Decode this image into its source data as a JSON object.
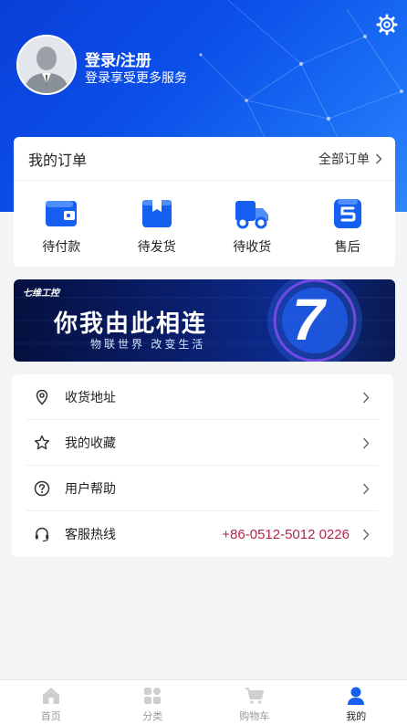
{
  "profile": {
    "login_title": "登录/注册",
    "login_subtitle": "登录享受更多服务",
    "avatar_icon": "avatar-placeholder-icon",
    "settings_icon": "gear-icon"
  },
  "orders": {
    "title": "我的订单",
    "all_label": "全部订单",
    "items": [
      {
        "label": "待付款",
        "icon": "wallet-icon"
      },
      {
        "label": "待发货",
        "icon": "package-icon"
      },
      {
        "label": "待收货",
        "icon": "truck-icon"
      },
      {
        "label": "售后",
        "icon": "after-sale-icon"
      }
    ]
  },
  "banner": {
    "brand": "七维工控",
    "headline": "你我由此相连",
    "tagline": "物联世界 改变生活",
    "badge": "7"
  },
  "menu": {
    "items": [
      {
        "label": "收货地址",
        "icon": "location-pin-icon",
        "value": ""
      },
      {
        "label": "我的收藏",
        "icon": "star-icon",
        "value": ""
      },
      {
        "label": "用户帮助",
        "icon": "help-circle-icon",
        "value": ""
      },
      {
        "label": "客服热线",
        "icon": "headset-icon",
        "value": "+86-0512-5012 0226"
      }
    ]
  },
  "tabbar": {
    "items": [
      {
        "label": "首页",
        "icon": "home-icon"
      },
      {
        "label": "分类",
        "icon": "category-grid-icon"
      },
      {
        "label": "购物车",
        "icon": "cart-icon"
      },
      {
        "label": "我的",
        "icon": "user-icon"
      }
    ],
    "active_index": 3
  },
  "colors": {
    "brand_blue": "#0b4fe8",
    "accent_icon_blue": "#1560f0",
    "hotline_red": "#b0284a"
  }
}
